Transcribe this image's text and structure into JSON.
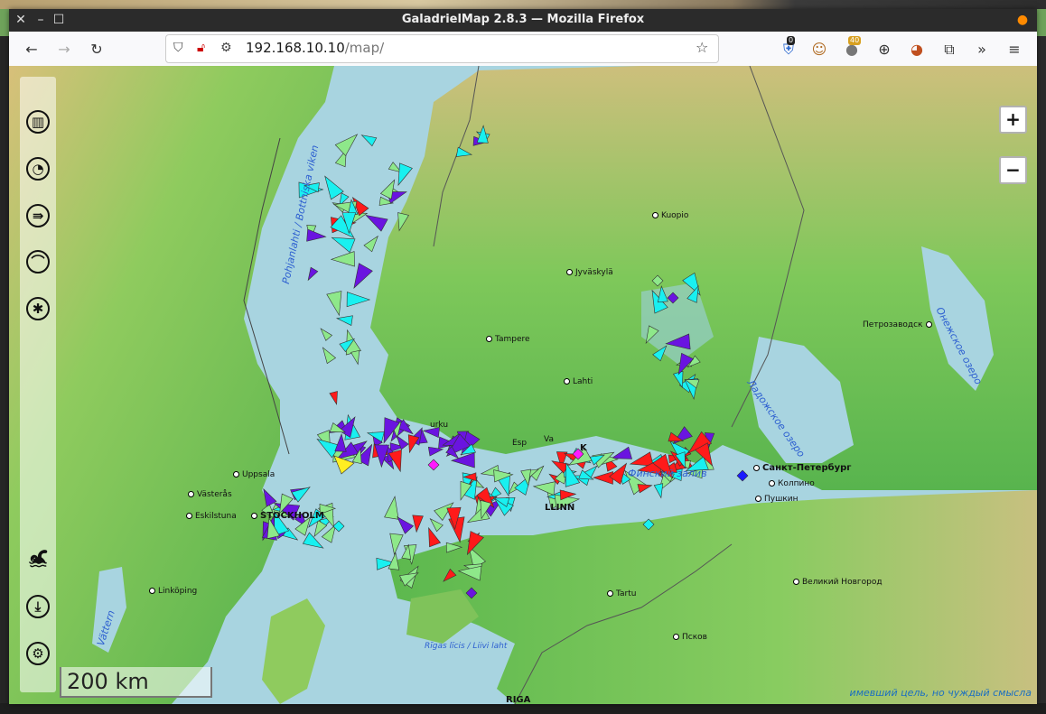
{
  "window": {
    "title": "GaladrielMap 2.8.3 — Mozilla Firefox"
  },
  "toolbar": {
    "url_host": "192.168.10.10",
    "url_path": "/map/",
    "ext_badge_1": "0",
    "ext_badge_2": "40"
  },
  "map": {
    "zoom_in": "+",
    "zoom_out": "−",
    "scale_label": "200 km",
    "attribution": "имевший цель, но чуждый смысла",
    "cities": [
      {
        "name": "Kuopio",
        "big": false
      },
      {
        "name": "Jyväskylä",
        "big": false
      },
      {
        "name": "Tampere",
        "big": false
      },
      {
        "name": "Lahti",
        "big": false
      },
      {
        "name": "Петрозаводск",
        "big": false
      },
      {
        "name": "Санкт-Петербург",
        "big": true
      },
      {
        "name": "Колпино",
        "big": false
      },
      {
        "name": "Пушкин",
        "big": false
      },
      {
        "name": "Uppsala",
        "big": false
      },
      {
        "name": "Västerås",
        "big": false
      },
      {
        "name": "Eskilstuna",
        "big": false
      },
      {
        "name": "Linköping",
        "big": false
      },
      {
        "name": "Tartu",
        "big": false
      },
      {
        "name": "Великий Новгород",
        "big": false
      },
      {
        "name": "Псков",
        "big": false
      },
      {
        "name": "RIGA",
        "big": true
      },
      {
        "name": "LLINN",
        "big": true
      },
      {
        "name": "STOCKHOLM",
        "big": true
      },
      {
        "name": "urku",
        "big": false
      },
      {
        "name": "Esp",
        "big": false
      },
      {
        "name": "Va",
        "big": false
      },
      {
        "name": "K",
        "big": true
      }
    ],
    "water_labels": [
      "Pohjanlahti / Bottniska viken",
      "Ладожское озеро",
      "Онежское озеро",
      "Vättern",
      "Rīgas līcis / Liivi laht",
      "Финский залив"
    ]
  },
  "colors": {
    "sea": "#a8d4e0",
    "land_low": "#5fba52",
    "land_high": "#d8c07a",
    "vessel_green": "#8ee88a",
    "vessel_cyan": "#19f0f0",
    "vessel_purple": "#6a14e0",
    "vessel_red": "#ff1a1a",
    "vessel_magenta": "#ff1aff",
    "vessel_yellow": "#ffee22",
    "vessel_blue": "#1a1aff"
  },
  "icons": {
    "left_panel": [
      "layers-icon",
      "dashboard-icon",
      "route-icon",
      "measure-icon",
      "ais-icon",
      "swimmer-icon",
      "download-icon",
      "settings-icon"
    ]
  }
}
